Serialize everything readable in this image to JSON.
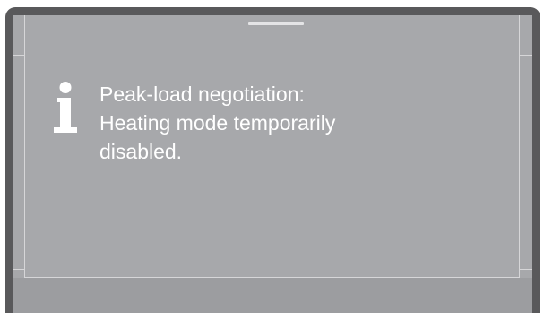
{
  "dialog": {
    "icon": "info-icon",
    "message_lines": [
      "Peak-load negotiation:",
      "Heating mode temporarily",
      "disabled."
    ]
  },
  "colors": {
    "bezel": "#59595b",
    "screen": "#a7a8ab",
    "text": "#ffffff",
    "lines": "#d6d6d8"
  }
}
